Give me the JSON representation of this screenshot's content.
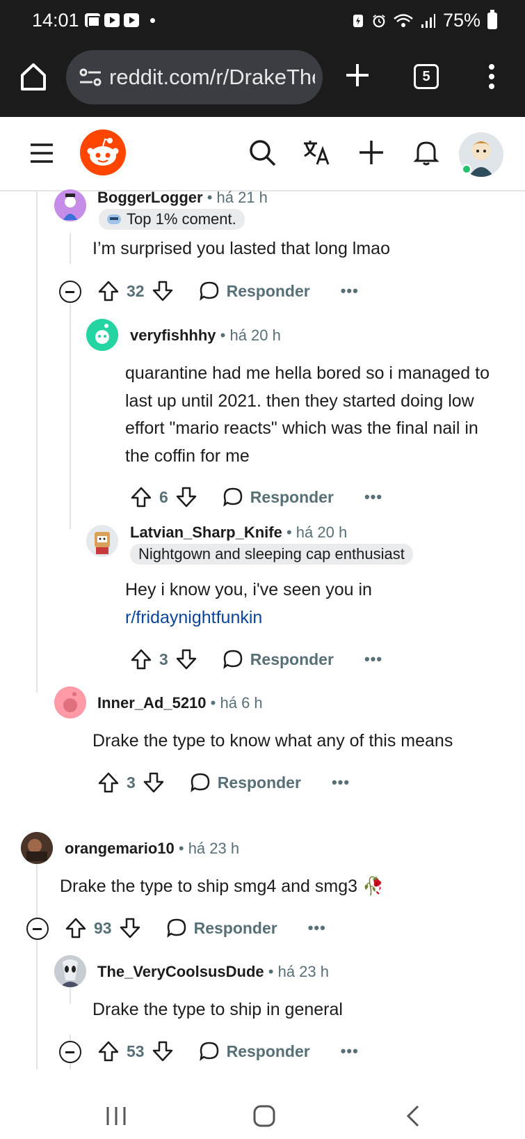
{
  "status_bar": {
    "time": "14:01",
    "battery": "75%"
  },
  "browser": {
    "url": "reddit.com/r/DrakeTheType",
    "tab_count": "5"
  },
  "comments": [
    {
      "username": "BoggerLogger",
      "age": "há 21 h",
      "flair": "Top 1% coment.",
      "text": "I’m surprised you lasted that long lmao",
      "votes": "32",
      "reply_label": "Responder",
      "more": "•••"
    },
    {
      "username": "veryfishhhy",
      "age": "há 20 h",
      "text": "quarantine had me hella bored so i managed to last up until 2021. then they started doing low effort \"mario reacts\" which was the final nail in the coffin for me",
      "votes": "6",
      "reply_label": "Responder",
      "more": "•••"
    },
    {
      "username": "Latvian_Sharp_Knife",
      "age": "há 20 h",
      "flair": "Nightgown and sleeping cap enthusiast",
      "text": "Hey i know you, i've seen you in",
      "link": "r/fridaynightfunkin",
      "votes": "3",
      "reply_label": "Responder",
      "more": "•••"
    },
    {
      "username": "Inner_Ad_5210",
      "age": "há 6 h",
      "text": "Drake the type to know what any of this means",
      "votes": "3",
      "reply_label": "Responder",
      "more": "•••"
    },
    {
      "username": "orangemario10",
      "age": "há 23 h",
      "text": "Drake the type to ship smg4 and smg3 🥀",
      "votes": "93",
      "reply_label": "Responder",
      "more": "•••"
    },
    {
      "username": "The_VeryCoolsusDude",
      "age": "há 23 h",
      "text": "Drake the type to ship in general",
      "votes": "53",
      "reply_label": "Responder",
      "more": "•••"
    }
  ],
  "colors": {
    "reddit_orange": "#ff4500",
    "link": "#0a449b",
    "meta": "#576f76"
  }
}
